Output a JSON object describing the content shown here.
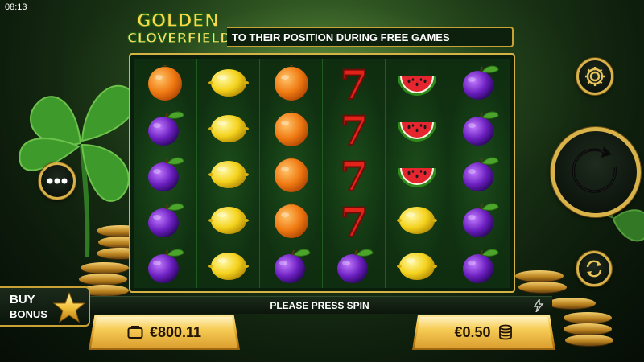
{
  "status_bar_time": "08:13",
  "logo": {
    "line1": "GOLDEN",
    "line2": "CLOVERFIELD"
  },
  "marquee": {
    "text": "TO THEIR POSITION DURING FREE GAMES"
  },
  "reels": [
    [
      "orange",
      "plum",
      "plum",
      "plum",
      "plum"
    ],
    [
      "lemon",
      "lemon",
      "lemon",
      "lemon",
      "lemon"
    ],
    [
      "orange",
      "orange",
      "orange",
      "orange",
      "plum"
    ],
    [
      "seven",
      "seven",
      "seven",
      "seven",
      "plum"
    ],
    [
      "watermelon",
      "watermelon",
      "watermelon",
      "lemon",
      "lemon"
    ],
    [
      "plum",
      "plum",
      "plum",
      "plum",
      "plum"
    ]
  ],
  "status_message": "PLEASE PRESS SPIN",
  "buy_bonus": {
    "line1": "BUY",
    "line2": "BONUS"
  },
  "balance": {
    "value": "€800.11",
    "icon": "wallet-icon"
  },
  "bet": {
    "value": "€0.50",
    "icon": "coin-stack-icon"
  },
  "buttons": {
    "settings_icon": "gear-icon",
    "spin_icon": "spin-arrow-icon",
    "autoplay_icon": "autoplay-icon",
    "menu_icon": "more-icon"
  },
  "colors": {
    "accent_gold": "#d9b24a",
    "felt_green": "#113612",
    "text_dark": "#231505"
  }
}
